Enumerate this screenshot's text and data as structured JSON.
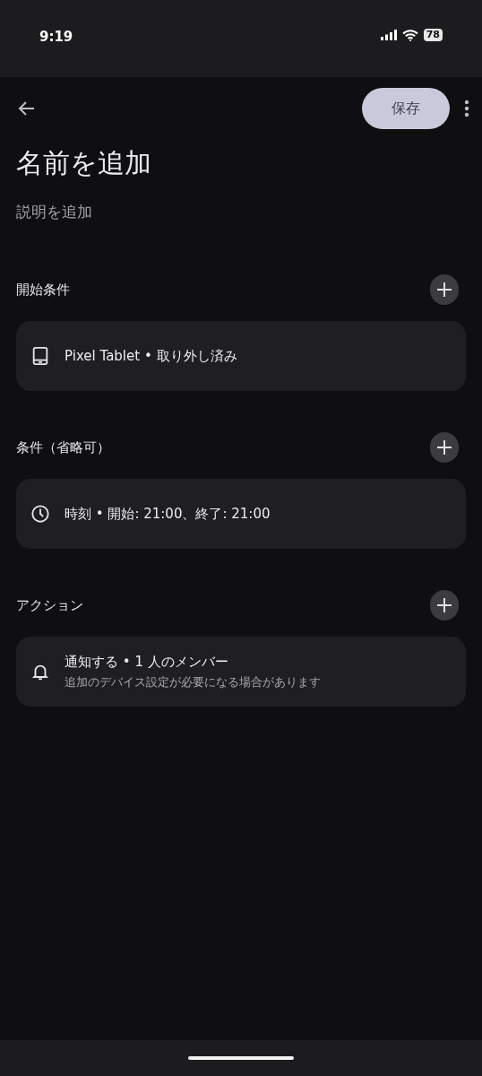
{
  "status_bar": {
    "time": "9:19",
    "battery": "78"
  },
  "toolbar": {
    "save_button": "保存"
  },
  "title": "名前を追加",
  "description": "説明を追加",
  "sections": [
    {
      "heading": "開始条件",
      "items": [
        {
          "kind": "tablet",
          "text": "Pixel Tablet • 取り外し済み"
        }
      ]
    },
    {
      "heading": "条件（省略可）",
      "items": [
        {
          "kind": "clock",
          "text": "時刻 • 開始: 21:00、終了: 21:00"
        }
      ]
    },
    {
      "heading": "アクション",
      "items": [
        {
          "kind": "bell",
          "text": "通知する • 1 人のメンバー",
          "subtext": "追加のデバイス設定が必要になる場合があります"
        }
      ]
    }
  ]
}
